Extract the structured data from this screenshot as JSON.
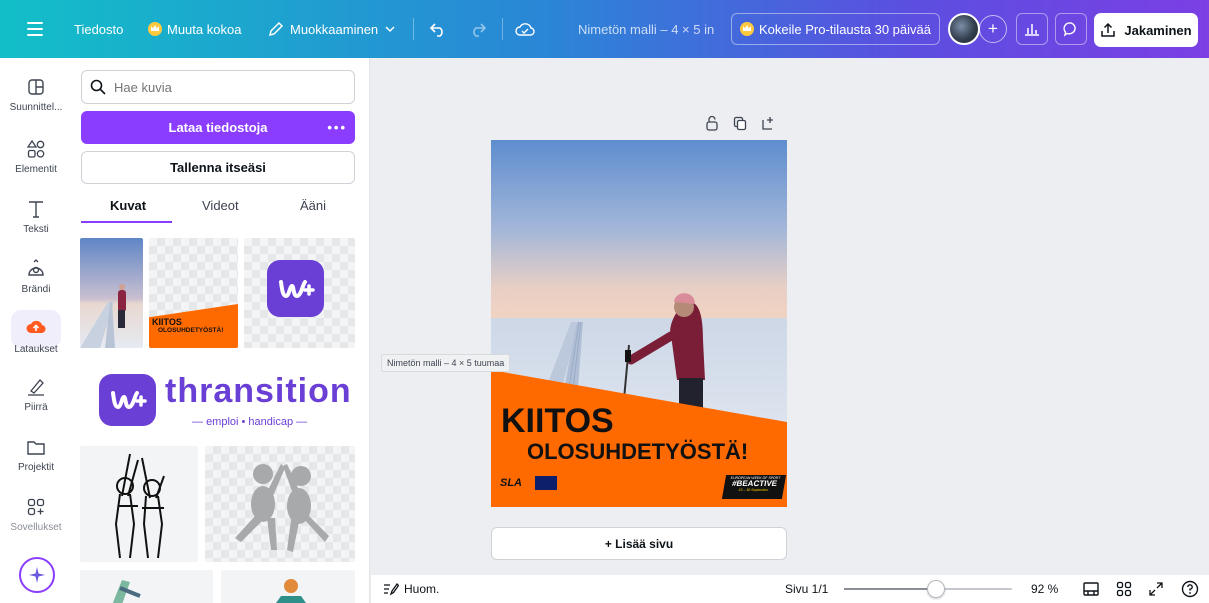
{
  "topbar": {
    "file_label": "Tiedosto",
    "resize_label": "Muuta kokoa",
    "edit_label": "Muokkaaminen",
    "title": "Nimetön malli – 4 × 5 in",
    "pro_trial_label": "Kokeile Pro-tilausta 30 päivää",
    "share_label": "Jakaminen"
  },
  "rail": {
    "items": [
      {
        "label": "Suunnittel..."
      },
      {
        "label": "Elementit"
      },
      {
        "label": "Teksti"
      },
      {
        "label": "Brändi"
      },
      {
        "label": "Lataukset"
      },
      {
        "label": "Piirrä"
      },
      {
        "label": "Projektit"
      },
      {
        "label": "Sovellukset"
      }
    ]
  },
  "panel": {
    "search_placeholder": "Hae kuvia",
    "upload_label": "Lataa tiedostoja",
    "record_label": "Tallenna itseäsi",
    "tabs": [
      "Kuvat",
      "Videot",
      "Ääni"
    ],
    "thumb_kiitos_line1": "KIITOS",
    "thumb_kiitos_line2": "OLOSUHDETYÖSTÄ!",
    "thranition_word": "thransition",
    "thranition_sub": "emploi • handicap"
  },
  "canvas": {
    "tooltip": "Nimetön malli – 4 × 5 tuumaa",
    "design_line1": "KIITOS",
    "design_line2": "OLOSUHDETYÖSTÄ!",
    "logo_sla": "SLA",
    "badge_top": "EUROPEAN WEEK OF SPORT",
    "badge_main": "#BEACTIVE",
    "badge_dates": "23 – 30 September",
    "add_page_label": "+ Lisää sivu"
  },
  "bottombar": {
    "notes_label": "Huom.",
    "page_label": "Sivu 1/1",
    "zoom_label": "92 %",
    "zoom_fraction": 0.55
  },
  "colors": {
    "accent": "#8b3dff",
    "orange": "#ff6a00",
    "thranition_purple": "#6a3fd6"
  }
}
